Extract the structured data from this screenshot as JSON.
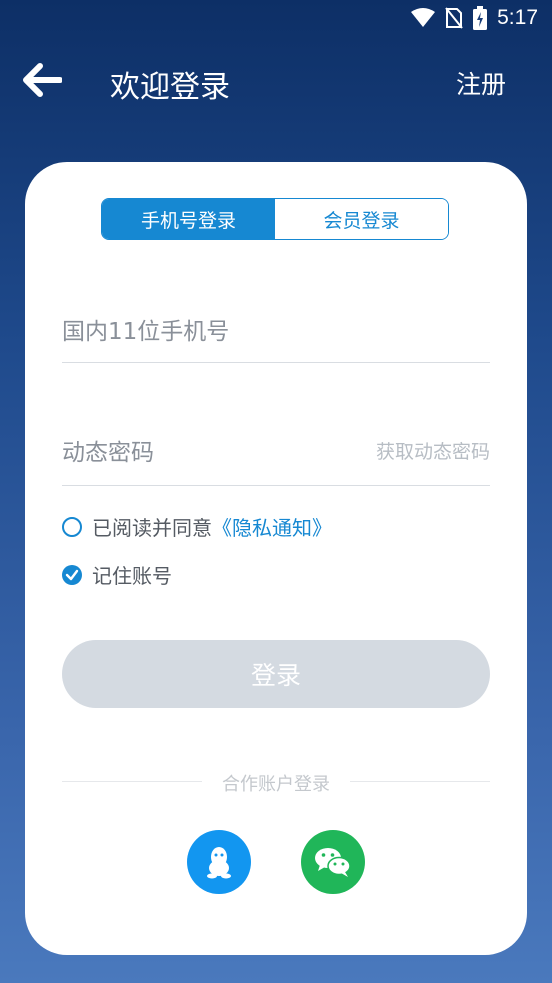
{
  "status_bar": {
    "time": "5:17"
  },
  "header": {
    "title": "欢迎登录",
    "register_label": "注册"
  },
  "login_tabs": [
    {
      "label": "手机号登录",
      "active": true
    },
    {
      "label": "会员登录",
      "active": false
    }
  ],
  "phone_field": {
    "placeholder": "国内11位手机号"
  },
  "password_field": {
    "placeholder": "动态密码",
    "action_label": "获取动态密码"
  },
  "agreement": {
    "prefix": "已阅读并同意",
    "link": "《隐私通知》",
    "checked": false
  },
  "remember": {
    "label": "记住账号",
    "checked": true
  },
  "login_button": {
    "label": "登录"
  },
  "partner": {
    "label": "合作账户登录",
    "providers": [
      {
        "name": "qq-icon",
        "color": "#1296f0"
      },
      {
        "name": "wechat-icon",
        "color": "#20b659"
      }
    ]
  },
  "colors": {
    "accent": "#1688d2",
    "button_disabled": "#d4dae1"
  }
}
